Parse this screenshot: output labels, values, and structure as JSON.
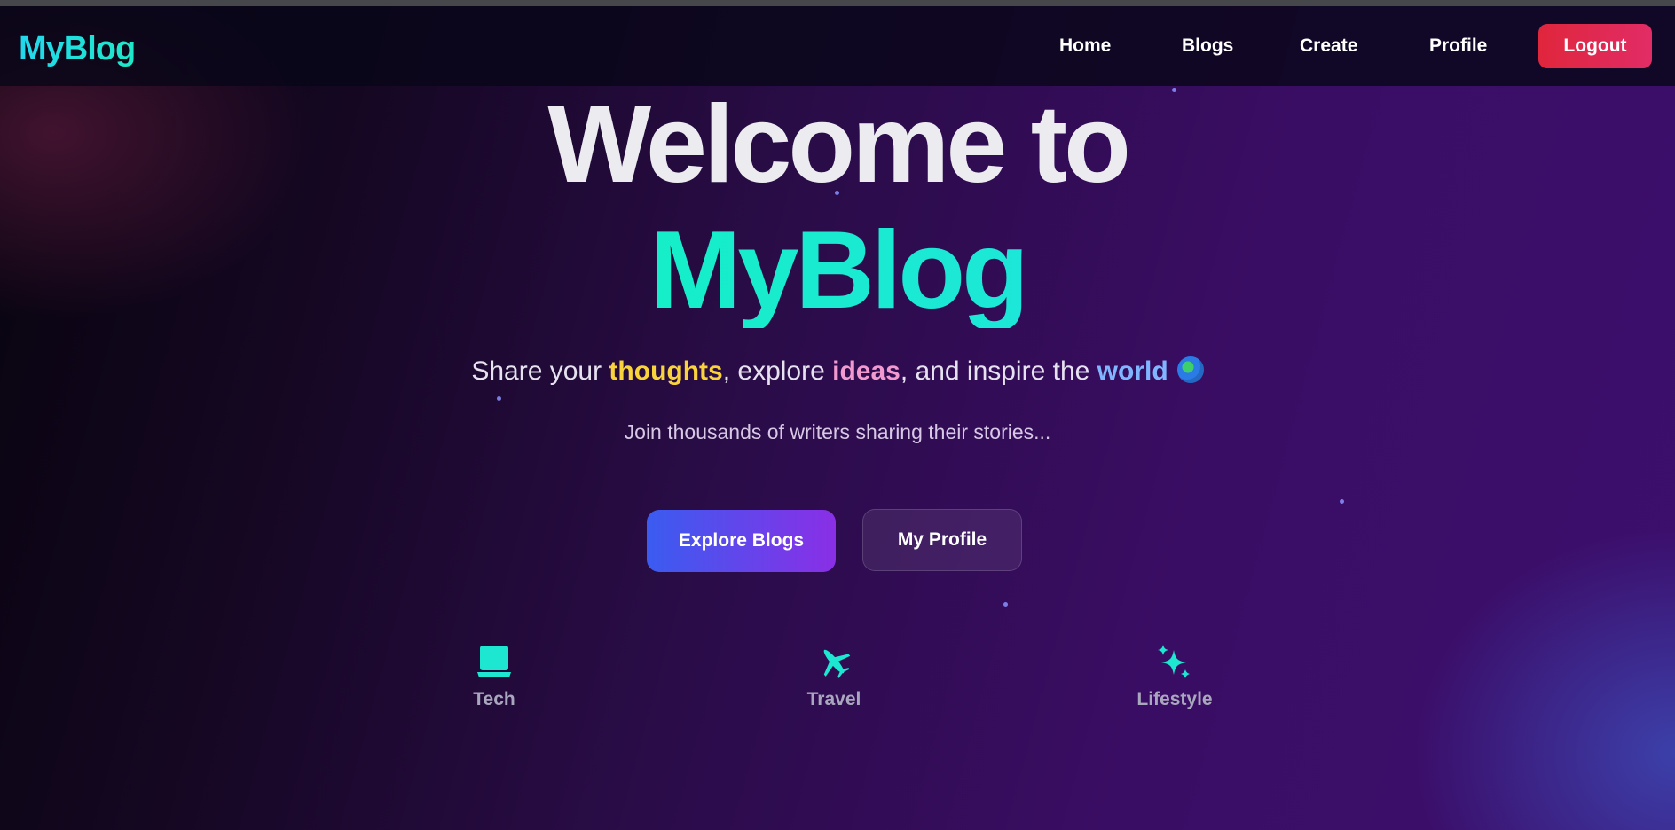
{
  "nav": {
    "brand": "MyBlog",
    "links": [
      "Home",
      "Blogs",
      "Create",
      "Profile"
    ],
    "logout": "Logout"
  },
  "hero": {
    "title_line1": "Welcome to",
    "title_line2": "MyBlog",
    "tagline": {
      "part1": "Share your ",
      "highlight1": "thoughts",
      "part2": ", explore ",
      "highlight2": "ideas",
      "part3": ", and inspire the ",
      "highlight3": "world"
    },
    "subline": "Join thousands of writers sharing their stories...",
    "primary_button": "Explore Blogs",
    "secondary_button": "My Profile"
  },
  "categories": [
    {
      "label": "Tech",
      "icon": "laptop-icon"
    },
    {
      "label": "Travel",
      "icon": "airplane-icon"
    },
    {
      "label": "Lifestyle",
      "icon": "sparkles-icon"
    }
  ],
  "colors": {
    "accent_teal": "#1de7d0",
    "thoughts": "#f8d33b",
    "ideas": "#f29ad0",
    "world": "#7fb6ff",
    "logout": "#e0263c"
  }
}
